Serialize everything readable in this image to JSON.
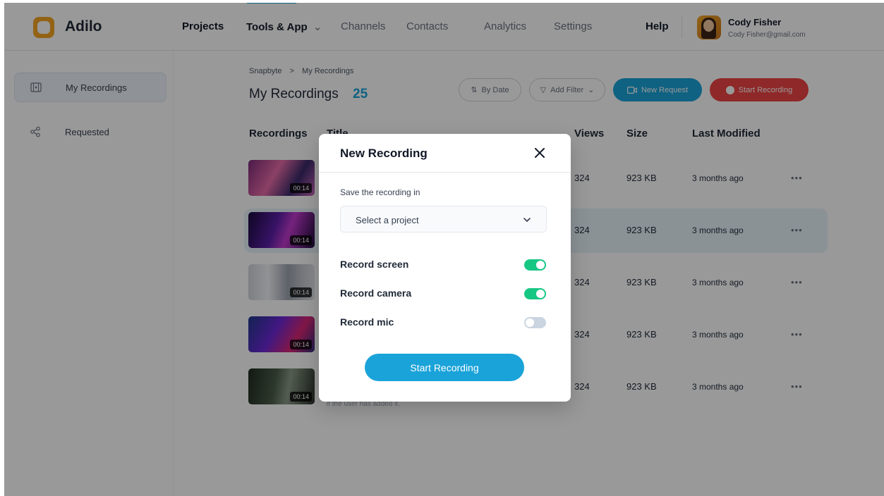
{
  "header": {
    "brand": "Adilo",
    "nav": [
      "Projects",
      "Tools & App",
      "Channels",
      "Contacts",
      "Analytics",
      "Settings"
    ],
    "tools_chevron": "⌄",
    "help": "Help",
    "user_name": "Cody Fisher",
    "user_email": "Cody Fisher@gmail.com"
  },
  "sidebar": {
    "items": [
      {
        "label": "My Recordings",
        "icon": "film-icon",
        "active": true
      },
      {
        "label": "Requested",
        "icon": "share-icon",
        "active": false
      }
    ]
  },
  "main": {
    "breadcrumb": [
      "Snapbyte",
      ">",
      "My Recordings"
    ],
    "title": "My Recordings",
    "count": "25",
    "buttons": {
      "by_date": "By Date",
      "add_filter": "Add Filter",
      "new_request": "New Request",
      "start_recording": "Start Recording"
    },
    "columns": [
      "Recordings",
      "Title",
      "Views",
      "Size",
      "Last Modified"
    ],
    "rows": [
      {
        "duration": "00:14",
        "views": "324",
        "size": "923 KB",
        "modified": "3 months ago"
      },
      {
        "duration": "00:14",
        "views": "324",
        "size": "923 KB",
        "modified": "3 months ago"
      },
      {
        "duration": "00:14",
        "views": "324",
        "size": "923 KB",
        "modified": "3 months ago"
      },
      {
        "duration": "00:14",
        "views": "324",
        "size": "923 KB",
        "modified": "3 months ago"
      },
      {
        "duration": "00:14",
        "views": "324",
        "size": "923 KB",
        "modified": "3 months ago"
      }
    ],
    "more": "•••",
    "desc_tail": "if the user has added it."
  },
  "modal": {
    "title": "New Recording",
    "save_label": "Save the recording in",
    "select_placeholder": "Select a project",
    "toggles": [
      {
        "label": "Record screen",
        "on": true
      },
      {
        "label": "Record camera",
        "on": true
      },
      {
        "label": "Record mic",
        "on": false
      }
    ],
    "start_button": "Start Recording"
  },
  "colors": {
    "accent": "#1aa3d9",
    "danger": "#ef4444",
    "toggle_on": "#16c784",
    "logo": "#f5a623"
  }
}
